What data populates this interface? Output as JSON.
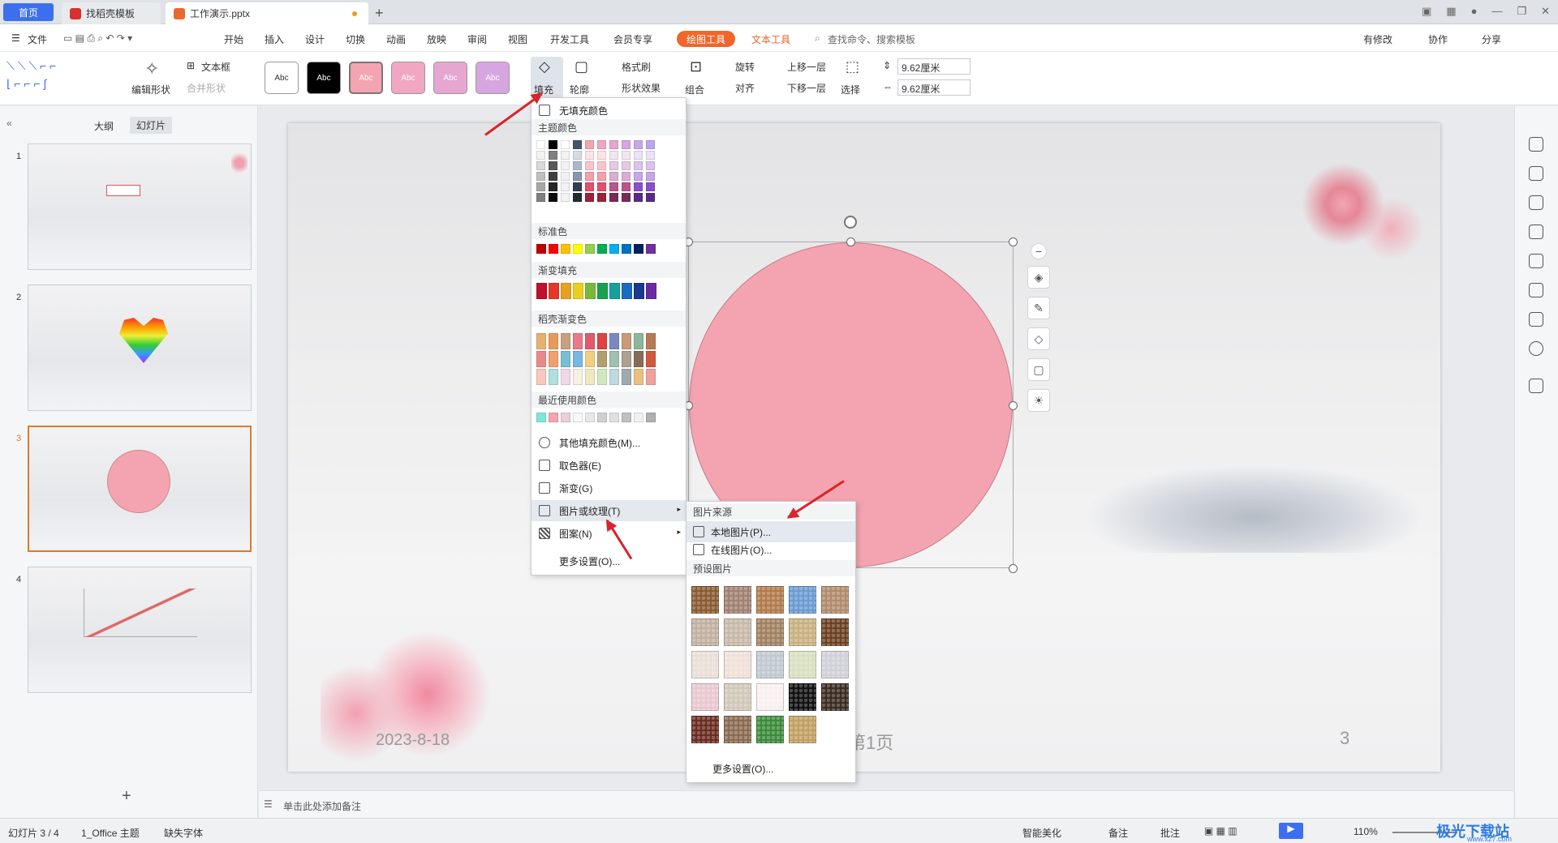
{
  "tabs": {
    "home": "首页",
    "template": "找稻壳模板",
    "file": "工作演示.pptx"
  },
  "menu": {
    "file": "文件",
    "items": [
      "开始",
      "插入",
      "设计",
      "切换",
      "动画",
      "放映",
      "审阅",
      "视图",
      "开发工具",
      "会员专享"
    ],
    "drawing_tools": "绘图工具",
    "text_tools": "文本工具",
    "search": "查找命令、搜索模板",
    "right": [
      "有修改",
      "协作",
      "分享"
    ]
  },
  "ribbon": {
    "edit_shape": "编辑形状",
    "textbox": "文本框",
    "merge_shape": "合并形状",
    "styles": [
      "Abc",
      "Abc",
      "Abc",
      "Abc",
      "Abc",
      "Abc"
    ],
    "fill": "填充",
    "outline": "轮廓",
    "format_brush": "格式刷",
    "shape_effect": "形状效果",
    "combine": "组合",
    "rotate": "旋转",
    "align": "对齐",
    "move_up": "上移一层",
    "move_down": "下移一层",
    "select": "选择",
    "height": "9.62厘米",
    "width": "9.62厘米"
  },
  "leftpane": {
    "outline": "大纲",
    "slides": "幻灯片",
    "numbers": [
      "1",
      "2",
      "3",
      "4"
    ]
  },
  "slide": {
    "date": "2023-8-18",
    "page_text": "第1页",
    "page_number": "3"
  },
  "fill_menu": {
    "no_fill": "无填充颜色",
    "theme_colors": "主题颜色",
    "standard_colors": "标准色",
    "gradient_fill": "渐变填充",
    "docer_gradient": "稻壳渐变色",
    "recent_colors": "最近使用颜色",
    "more_fill_colors": "其他填充颜色(M)...",
    "eyedropper": "取色器(E)",
    "gradient": "渐变(G)",
    "picture_texture": "图片或纹理(T)",
    "pattern": "图案(N)",
    "more_settings": "更多设置(O)..."
  },
  "submenu": {
    "picture_source": "图片来源",
    "local_picture": "本地图片(P)...",
    "online_picture": "在线图片(O)...",
    "preset_pictures": "预设图片",
    "more_settings": "更多设置(O)..."
  },
  "notes": {
    "placeholder": "单击此处添加备注"
  },
  "status": {
    "slide_info": "幻灯片 3 / 4",
    "theme": "1_Office 主题",
    "missing_font": "缺失字体",
    "beautify": "智能美化",
    "notes": "备注",
    "comments": "批注",
    "zoom": "110%"
  },
  "watermark": "极光下载站",
  "watermark_url": "www.xz7.com",
  "colors": {
    "accent": "#3c6ff0",
    "drawing_tools_pill": "#f0662b",
    "circle_fill": "#f4a4b0",
    "arrow": "#d8242a",
    "selected_thumb_border": "#e0782b"
  }
}
